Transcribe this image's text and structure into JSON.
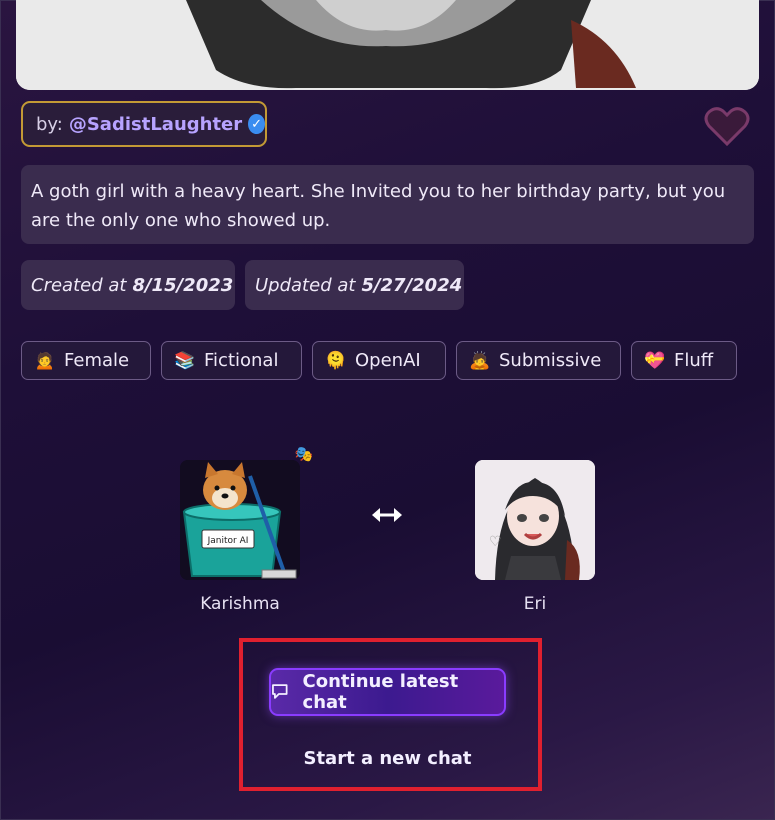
{
  "author": {
    "by_label": "by:",
    "handle": "@SadistLaughter"
  },
  "description": "A goth girl with a heavy heart. She Invited you to her birthday party, but you are the only one who showed up.",
  "dates": {
    "created_label": "Created at",
    "created_value": "8/15/2023",
    "updated_label": "Updated at",
    "updated_value": "5/27/2024"
  },
  "tags": [
    {
      "emoji": "🙍",
      "label": "Female"
    },
    {
      "emoji": "📚",
      "label": "Fictional"
    },
    {
      "emoji": "🫠",
      "label": "OpenAI"
    },
    {
      "emoji": "🙇",
      "label": "Submissive"
    },
    {
      "emoji": "💝",
      "label": "Fluff"
    }
  ],
  "personas": {
    "user_name": "Karishma",
    "user_image_text": "Janitor AI",
    "character_name": "Eri"
  },
  "actions": {
    "continue_label": "Continue latest chat",
    "new_chat_label": "Start a new chat"
  },
  "colors": {
    "accent": "#8a3cff",
    "highlight": "#e0202f",
    "badge_gold": "#c39a35"
  }
}
